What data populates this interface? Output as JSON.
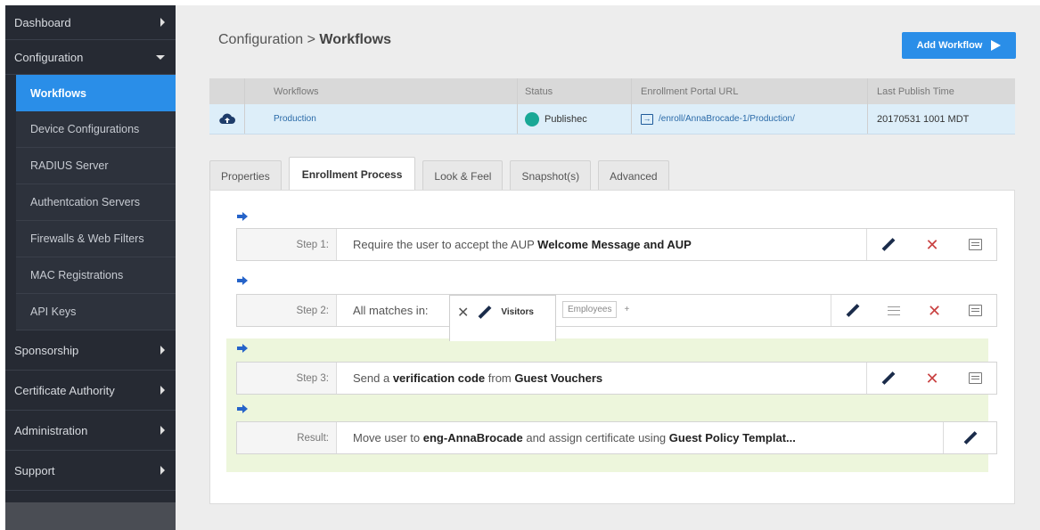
{
  "sidebar": {
    "items": [
      {
        "label": "Dashboard"
      },
      {
        "label": "Configuration"
      }
    ],
    "config_subitems": [
      {
        "label": "Workflows"
      },
      {
        "label": "Device Configurations"
      },
      {
        "label": "RADIUS Server"
      },
      {
        "label": "Authentcation Servers"
      },
      {
        "label": "Firewalls & Web Filters"
      },
      {
        "label": "MAC Registrations"
      },
      {
        "label": "API Keys"
      }
    ],
    "bottom_items": [
      {
        "label": "Sponsorship"
      },
      {
        "label": "Certificate Authority"
      },
      {
        "label": "Administration"
      },
      {
        "label": "Support"
      }
    ]
  },
  "header": {
    "breadcrumb_parent": "Configuration",
    "breadcrumb_sep": ">",
    "breadcrumb_current": "Workflows",
    "add_button": "Add Workflow"
  },
  "workflow_table": {
    "columns": [
      "Workflows",
      "Status",
      "Enrollment Portal URL",
      "Last Publish Time"
    ],
    "row": {
      "name": "Production",
      "status": "Publishec",
      "url": "/enroll/AnnaBrocade-1/Production/",
      "last_publish": "20170531 1001 MDT"
    }
  },
  "tabs": [
    "Properties",
    "Enrollment Process",
    "Look & Feel",
    "Snapshot(s)",
    "Advanced"
  ],
  "steps": {
    "step1": {
      "label": "Step 1:",
      "pre": "Require the user to accept the AUP ",
      "bold": "Welcome Message and AUP"
    },
    "step2": {
      "label": "Step 2:",
      "text": "All matches in:",
      "chip_selected": "Visitors",
      "chip_other": "Employees",
      "add": "+"
    },
    "step3": {
      "label": "Step 3:",
      "pre": "Send a ",
      "bold1": "verification code",
      "mid": " from ",
      "bold2": "Guest Vouchers"
    },
    "result": {
      "label": "Result:",
      "pre": "Move user to ",
      "bold1": "eng-AnnaBrocade",
      "mid": " and assign certificate using ",
      "bold2": "Guest Policy Templat..."
    }
  },
  "icons": {
    "upload": "cloud-upload-icon",
    "portal": "enter-icon",
    "edit": "pencil-icon",
    "delete": "x-icon",
    "note": "note-icon",
    "reorder": "menu-icon"
  },
  "colors": {
    "accent": "#2a8ee8",
    "sidebar": "#262a33",
    "status_published": "#19a896",
    "delete": "#c94242",
    "green_zone": "#edf6dc"
  }
}
